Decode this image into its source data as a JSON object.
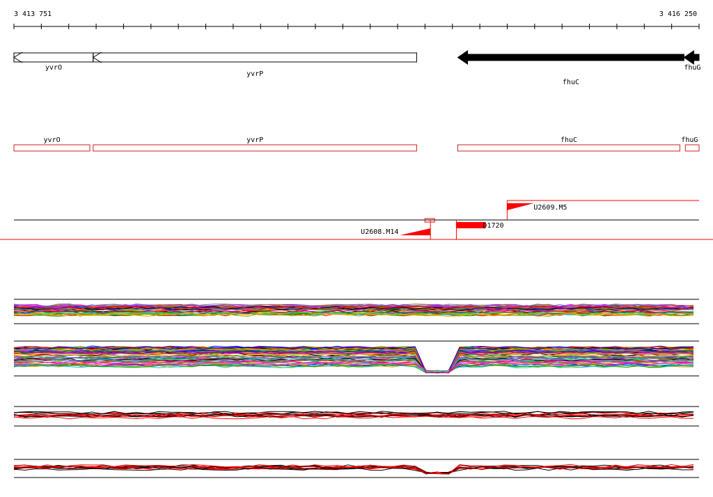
{
  "ruler": {
    "start_label": "3 413 751",
    "end_label": "3 416 250",
    "start": 3413751,
    "end": 3416250
  },
  "annotation_track": {
    "genes": [
      {
        "name": "yvrO",
        "label": "yvrO",
        "strand": "-",
        "style": "outline",
        "start": 3413751,
        "end": 3414040
      },
      {
        "name": "yvrP",
        "label": "yvrP",
        "strand": "-",
        "style": "outline",
        "start": 3414040,
        "end": 3415220
      },
      {
        "name": "fhuC",
        "label": "fhuC",
        "strand": "-",
        "style": "filled",
        "start": 3415370,
        "end": 3416195
      },
      {
        "name": "fhuG",
        "label": "fhuG",
        "strand": "-",
        "style": "filled",
        "start": 3416195,
        "end": 3416250
      }
    ]
  },
  "feature_track": {
    "genes": [
      {
        "label": "yvrO",
        "start": 3413751,
        "end": 3414028
      },
      {
        "label": "yvrP",
        "start": 3414040,
        "end": 3415220
      },
      {
        "label": "fhuC",
        "start": 3415370,
        "end": 3416180
      },
      {
        "label": "fhuG",
        "start": 3416200,
        "end": 3416250
      }
    ]
  },
  "transcription_units": [
    {
      "label": "U2609.M5",
      "position": 3415550,
      "side": "top"
    },
    {
      "label": "U2608.M14",
      "position": 3415260,
      "side": "bottom"
    },
    {
      "label": "D1720",
      "position": 3415380,
      "side": "bottom"
    }
  ],
  "colors": {
    "axis": "#000000",
    "gene_outline": "#000000",
    "gene_filled": "#000000",
    "feature_box": "#cc2222",
    "marker": "#ff0000",
    "profile_palette": [
      "#ff0000",
      "#00aa00",
      "#0000ff",
      "#ff00ff",
      "#00cccc",
      "#ffaa00",
      "#888888",
      "#aa00aa",
      "#008800",
      "#cc6600",
      "#6666ff",
      "#ccaa00",
      "#000000"
    ]
  }
}
